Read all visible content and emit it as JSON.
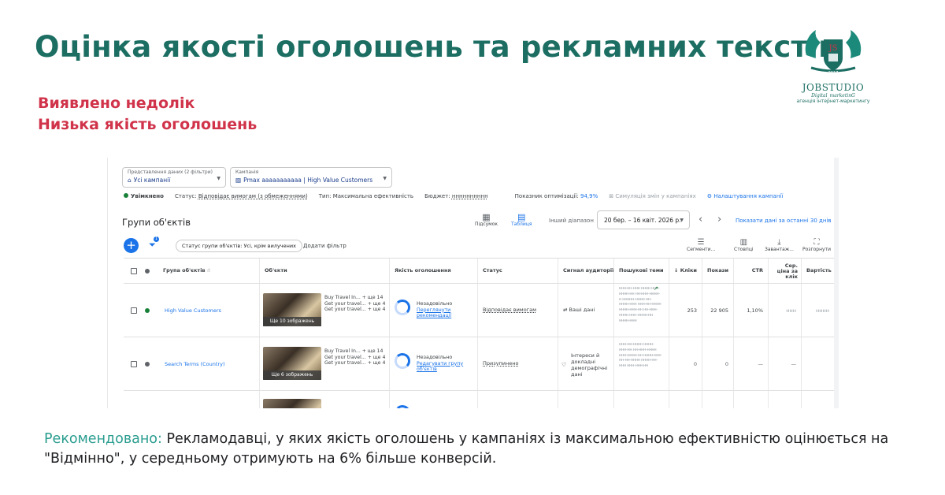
{
  "slide": {
    "title": "Оцінка якості оголошень та рекламних текстів",
    "issue_line1": "Виявлено недолік",
    "issue_line2": "Низька якість оголошень",
    "reco_lead": "Рекомендовано:",
    "reco_text": "Рекламодавці, у яких якість оголошень у кампаніях із максимальною ефективністю оцінюється на \"Відмінно\", у середньому отримують на 6% більше конверсій.",
    "logo": {
      "brand": "JOBSTUDIO",
      "sub1": "Digital_marketinG",
      "sub2": "агенція інтернет-маркетингу",
      "badge": "JS",
      "year": "2017"
    }
  },
  "ads": {
    "filter_view": {
      "label": "Представлення даних (2 фільтри)",
      "value": "Усі кампанії"
    },
    "filter_campaign": {
      "label": "Кампанія",
      "value": "Pmax ааааааааааа | High Value Customers"
    },
    "status": {
      "enabled": "Увімкнено",
      "status_label": "Статус:",
      "status_value": "Відповідає вимогам (з обмеженнями)",
      "type_label": "Тип:",
      "type_value": "Максимальна ефективність",
      "budget_label": "Бюджет:",
      "budget_value": "нннннннннн",
      "score_label": "Показник оптимізації:",
      "score_value": "94,9%",
      "simulation": "Симуляція змін у кампаніях",
      "settings": "Налаштування кампанії"
    },
    "toolbar": {
      "title": "Групи об'єктів",
      "view_summary": "Підсумок",
      "view_table": "Таблиця",
      "range_label": "Інший діапазон",
      "date_range": "20 бер. – 16 квіт. 2026 р.",
      "show_last": "Показати дані за останні 30 днів",
      "chip": "Статус групи об'єктів: Усі, крім вилучених",
      "add_filter": "Додати фільтр",
      "funnel_badge": "1",
      "tools": [
        "Сегменти...",
        "Стовпці",
        "Завантаж...",
        "Розгорнути"
      ]
    },
    "columns": [
      "Група об'єктів",
      "Об'єкти",
      "Якість оголошення",
      "Статус",
      "Сигнал аудиторії",
      "Пошукові теми",
      "Кліки",
      "Покази",
      "CTR",
      "Сер. ціна за клік",
      "Вартість"
    ],
    "rows": [
      {
        "name": "High Value Customers",
        "status_color": "#188038",
        "images": "Ще 10 зображень",
        "text1": "Buy Travel In...  + ще 14",
        "text2": "Get your travel...  + ще 4",
        "text3": "Get your travel...  + ще 4",
        "quality": "Незадовільно",
        "quality_link": "Переглянути рекомендації",
        "status": "Відповідає вимогам",
        "signal": "Ваші дані",
        "topics": "кнн-нн-ннн нннн ннн-нннн-нн нн-ннн-нннн-н ннннн-нннн нн-нннн-ннн ннн-нн-нннн нннн-ннн-нн нн-ннн-нннн ннн-нннн-нн нннн-ннн",
        "clicks": "253",
        "impressions": "22 905",
        "ctr": "1,10%",
        "cpc": "ннн",
        "cost": "нннн"
      },
      {
        "name": "Search Terms (Country)",
        "status_color": "#5f6368",
        "images": "Ще 6 зображень",
        "text1": "Buy Travel In...  + ще 14",
        "text2": "Get your travel...  + ще 4",
        "text3": "Get your travel...  + ще 4",
        "quality": "Незадовільно",
        "quality_link": "Редагувати групу об'єктів",
        "status": "Призупинено",
        "signal": "Інтереси й докладні демографічні дані",
        "topics": "ннн-нн-нннн нннн-ннн-нн нн-ннн-нннн ннн-нннн-нн нннн-ннн нн-нн-нннн нннн-нн-ннн ннн-ннн-нн",
        "clicks": "0",
        "impressions": "0",
        "ctr": "—",
        "cpc": "—",
        "cost": ""
      }
    ]
  }
}
